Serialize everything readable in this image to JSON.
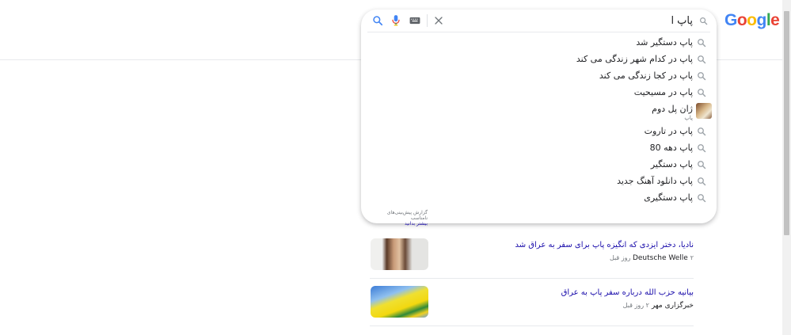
{
  "logo": {
    "letters": [
      "G",
      "o",
      "o",
      "g",
      "l",
      "e"
    ],
    "colors": [
      "#4285f4",
      "#ea4335",
      "#fbbc05",
      "#4285f4",
      "#34a853",
      "#ea4335"
    ]
  },
  "search": {
    "value": "پاپ ا"
  },
  "icons": {
    "search": "search-icon",
    "voice": "microphone-icon",
    "keyboard": "keyboard-icon",
    "clear": "close-icon"
  },
  "suggestions": [
    {
      "text": "پاپ دستگیر شد",
      "icon": "search-icon"
    },
    {
      "text": "پاپ در کدام شهر زندگی می کند",
      "icon": "search-icon"
    },
    {
      "text": "پاپ در کجا زندگی می کند",
      "icon": "search-icon"
    },
    {
      "text": "پاپ در مسیحیت",
      "icon": "search-icon"
    },
    {
      "text": "ژان پل دوم",
      "subtext": "پاپ",
      "icon": "thumbnail"
    },
    {
      "text": "پاپ در تاروت",
      "icon": "search-icon"
    },
    {
      "text": "پاپ دهه 80",
      "icon": "search-icon"
    },
    {
      "text": "پاپ دستگیر",
      "icon": "search-icon"
    },
    {
      "text": "پاپ دانلود آهنگ جدید",
      "icon": "search-icon"
    },
    {
      "text": "پاپ دستگیری",
      "icon": "search-icon"
    }
  ],
  "footer": {
    "report": "گزارش پیش‌بینی‌های نامناسب",
    "more": "بیشتر بدانید"
  },
  "news": [
    {
      "title": "نادیا، دختر ایزدی که انگیزه پاپ برای سفر به عراق شد",
      "source": "Deutsche Welle",
      "time": "۲ روز قبل"
    },
    {
      "title": "بیانیه حزب الله درباره سفر پاپ به عراق",
      "source": "خبرگزاری مهر",
      "time": "۲ روز قبل"
    }
  ]
}
